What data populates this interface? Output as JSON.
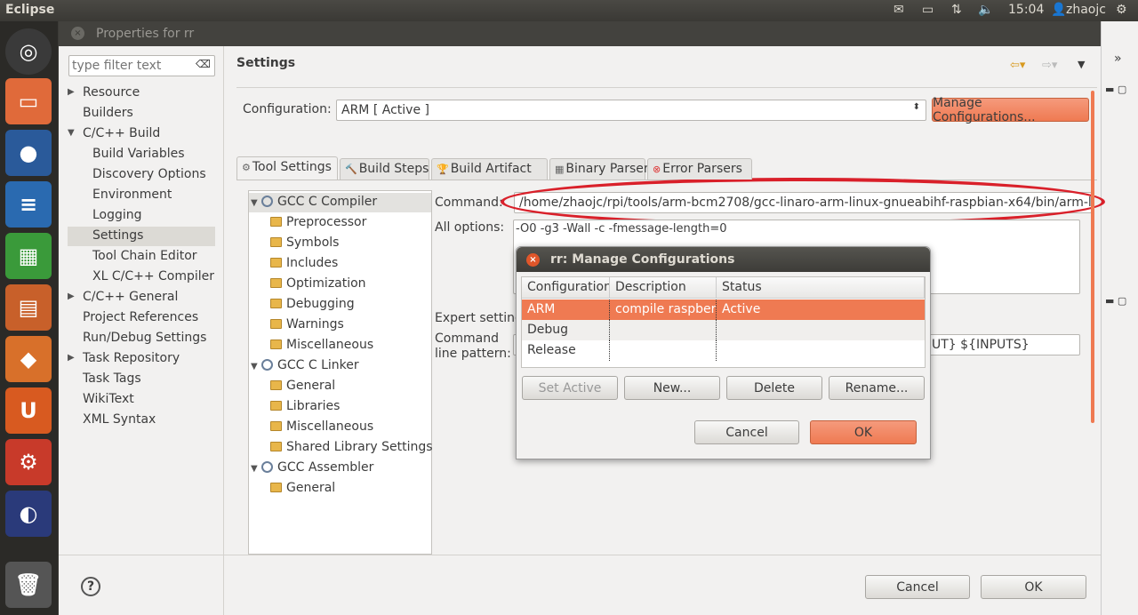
{
  "topbar": {
    "app": "Eclipse",
    "time": "15:04",
    "user": "zhaojc",
    "icons": [
      "mail-icon",
      "battery-icon",
      "network-icon",
      "volume-icon",
      "user-icon",
      "power-gear-icon"
    ]
  },
  "launcher": [
    "ubuntu-dash-icon",
    "files-icon",
    "firefox-icon",
    "writer-icon",
    "calc-icon",
    "impress-icon",
    "software-center-icon",
    "ubuntu-one-icon",
    "system-settings-icon",
    "eclipse-icon",
    "trash-icon"
  ],
  "dialog": {
    "title": "Properties for rr",
    "filter_placeholder": "type filter text",
    "nav": [
      {
        "label": "Resource",
        "indent": 0,
        "exp": "▶"
      },
      {
        "label": "Builders",
        "indent": 0
      },
      {
        "label": "C/C++ Build",
        "indent": 0,
        "exp": "▼"
      },
      {
        "label": "Build Variables",
        "indent": 1
      },
      {
        "label": "Discovery Options",
        "indent": 1
      },
      {
        "label": "Environment",
        "indent": 1
      },
      {
        "label": "Logging",
        "indent": 1
      },
      {
        "label": "Settings",
        "indent": 1,
        "selected": true
      },
      {
        "label": "Tool Chain Editor",
        "indent": 1
      },
      {
        "label": "XL C/C++ Compiler",
        "indent": 1
      },
      {
        "label": "C/C++ General",
        "indent": 0,
        "exp": "▶"
      },
      {
        "label": "Project References",
        "indent": 0
      },
      {
        "label": "Run/Debug Settings",
        "indent": 0
      },
      {
        "label": "Task Repository",
        "indent": 0,
        "exp": "▶"
      },
      {
        "label": "Task Tags",
        "indent": 0
      },
      {
        "label": "WikiText",
        "indent": 0
      },
      {
        "label": "XML Syntax",
        "indent": 0
      }
    ],
    "page_title": "Settings",
    "config_label": "Configuration:",
    "config_value": "ARM  [ Active ]",
    "manage_button": "Manage Configurations...",
    "tabs": [
      "Tool Settings",
      "Build Steps",
      "Build Artifact",
      "Binary Parsers",
      "Error Parsers"
    ],
    "tool_tree": [
      {
        "label": "GCC C Compiler",
        "type": "tool",
        "selected": true
      },
      {
        "label": "Preprocessor",
        "type": "folder"
      },
      {
        "label": "Symbols",
        "type": "folder"
      },
      {
        "label": "Includes",
        "type": "folder"
      },
      {
        "label": "Optimization",
        "type": "folder"
      },
      {
        "label": "Debugging",
        "type": "folder"
      },
      {
        "label": "Warnings",
        "type": "folder"
      },
      {
        "label": "Miscellaneous",
        "type": "folder"
      },
      {
        "label": "GCC C Linker",
        "type": "tool"
      },
      {
        "label": "General",
        "type": "folder"
      },
      {
        "label": "Libraries",
        "type": "folder"
      },
      {
        "label": "Miscellaneous",
        "type": "folder"
      },
      {
        "label": "Shared Library Settings",
        "type": "folder"
      },
      {
        "label": "GCC Assembler",
        "type": "tool"
      },
      {
        "label": "General",
        "type": "folder"
      }
    ],
    "command_label": "Command:",
    "command_value": "/home/zhaojc/rpi/tools/arm-bcm2708/gcc-linaro-arm-linux-gnueabihf-raspbian-x64/bin/arm-linux-gnueabihf-gcc",
    "all_options_label": "All options:",
    "all_options_value": "-O0 -g3 -Wall -c -fmessage-length=0",
    "expert_label": "Expert settings:",
    "pattern_label1": "Command",
    "pattern_label2": "line pattern:",
    "pattern_value_tail": "UT} ${INPUTS}",
    "cancel": "Cancel",
    "ok": "OK",
    "highlight_color": "#d9202a"
  },
  "modal": {
    "title": "rr: Manage Configurations",
    "columns": [
      "Configuration",
      "Description",
      "Status"
    ],
    "rows": [
      [
        "ARM",
        "compile raspberry",
        "Active"
      ],
      [
        "Debug",
        "",
        ""
      ],
      [
        "Release",
        "",
        ""
      ]
    ],
    "buttons": [
      "Set Active",
      "New...",
      "Delete",
      "Rename..."
    ],
    "cancel": "Cancel",
    "ok": "OK",
    "accent": "#ef7a52"
  }
}
